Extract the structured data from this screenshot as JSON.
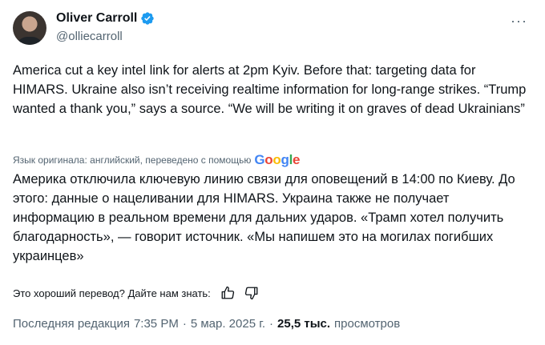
{
  "author": {
    "name": "Oliver Carroll",
    "handle": "@olliecarroll"
  },
  "tweet": {
    "original_text": "America cut a key intel link for alerts at 2pm Kyiv. Before that: targeting data for HIMARS. Ukraine also isn’t receiving realtime information for long-range strikes. “Trump wanted a thank you,” says a source. “We will be writing it on graves of dead Ukrainians”",
    "translation_label": "Язык оригинала: английский, переведено с помощью",
    "translation_provider": "Google",
    "translated_text": "Америка отключила ключевую линию связи для оповещений в 14:00 по Киеву. До этого: данные о нацеливании для HIMARS. Украина также не получает информацию в реальном времени для дальних ударов. «Трамп хотел получить благодарность», — говорит источник. «Мы напишем это на могилах погибших украинцев»"
  },
  "feedback": {
    "prompt": "Это хороший перевод? Дайте нам знать:"
  },
  "meta": {
    "edited_label": "Последняя редакция",
    "time": "7:35 PM",
    "separator": "·",
    "date": "5 мар. 2025 г.",
    "views_count": "25,5 тыс.",
    "views_label": "просмотров"
  },
  "icons": {
    "verified": "verified-badge-icon",
    "more": "more-icon",
    "thumbs_up": "thumbs-up-icon",
    "thumbs_down": "thumbs-down-icon"
  },
  "colors": {
    "verified_blue": "#1d9bf0",
    "secondary_text": "#536471",
    "primary_text": "#0f1419"
  }
}
